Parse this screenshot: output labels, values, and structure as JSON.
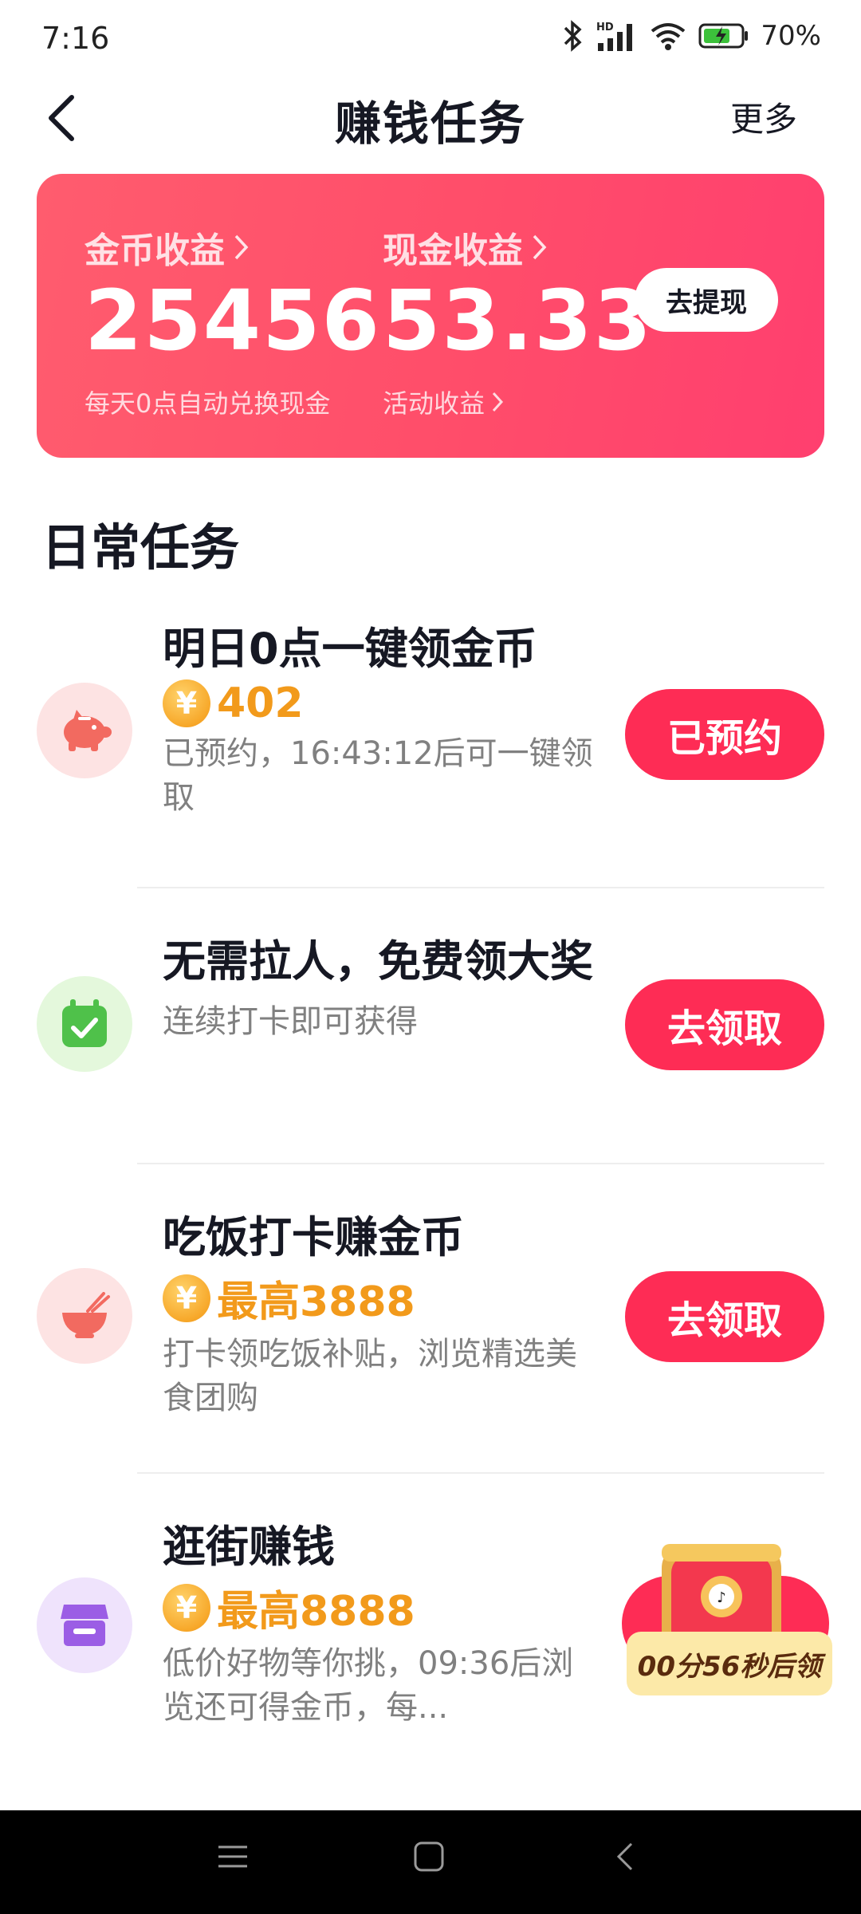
{
  "status_bar": {
    "time": "7:16",
    "network": "HD",
    "battery": "70%"
  },
  "header": {
    "title": "赚钱任务",
    "more": "更多"
  },
  "earnings": {
    "coin_label": "金币收益",
    "coin_value": "25456",
    "coin_sub": "每天0点自动兑换现金",
    "cash_label": "现金收益",
    "cash_value": "53.33",
    "cash_sub": "活动收益",
    "withdraw_button": "去提现",
    "card_color": "#ff4d6a"
  },
  "daily_section": {
    "title": "日常任务"
  },
  "tasks": [
    {
      "title": "明日0点一键领金币",
      "reward": "402",
      "description": "已预约，16:43:12后可一键领取",
      "button": "已预约",
      "icon": "piggy-bank-icon"
    },
    {
      "title": "无需拉人，免费领大奖",
      "description": "连续打卡即可获得",
      "button": "去领取",
      "icon": "calendar-check-icon"
    },
    {
      "title": "吃饭打卡赚金币",
      "reward": "最高3888",
      "description": "打卡领吃饭补贴，浏览精选美食团购",
      "button": "去领取",
      "icon": "rice-bowl-icon"
    },
    {
      "title": "逛街赚钱",
      "reward": "最高8888",
      "description": "低价好物等你挑，09:36后浏览还可得金币，每...",
      "timer": "00分56秒后领",
      "icon": "shop-icon"
    }
  ],
  "colors": {
    "accent": "#fe2c55",
    "coin": "#f29a1b"
  }
}
